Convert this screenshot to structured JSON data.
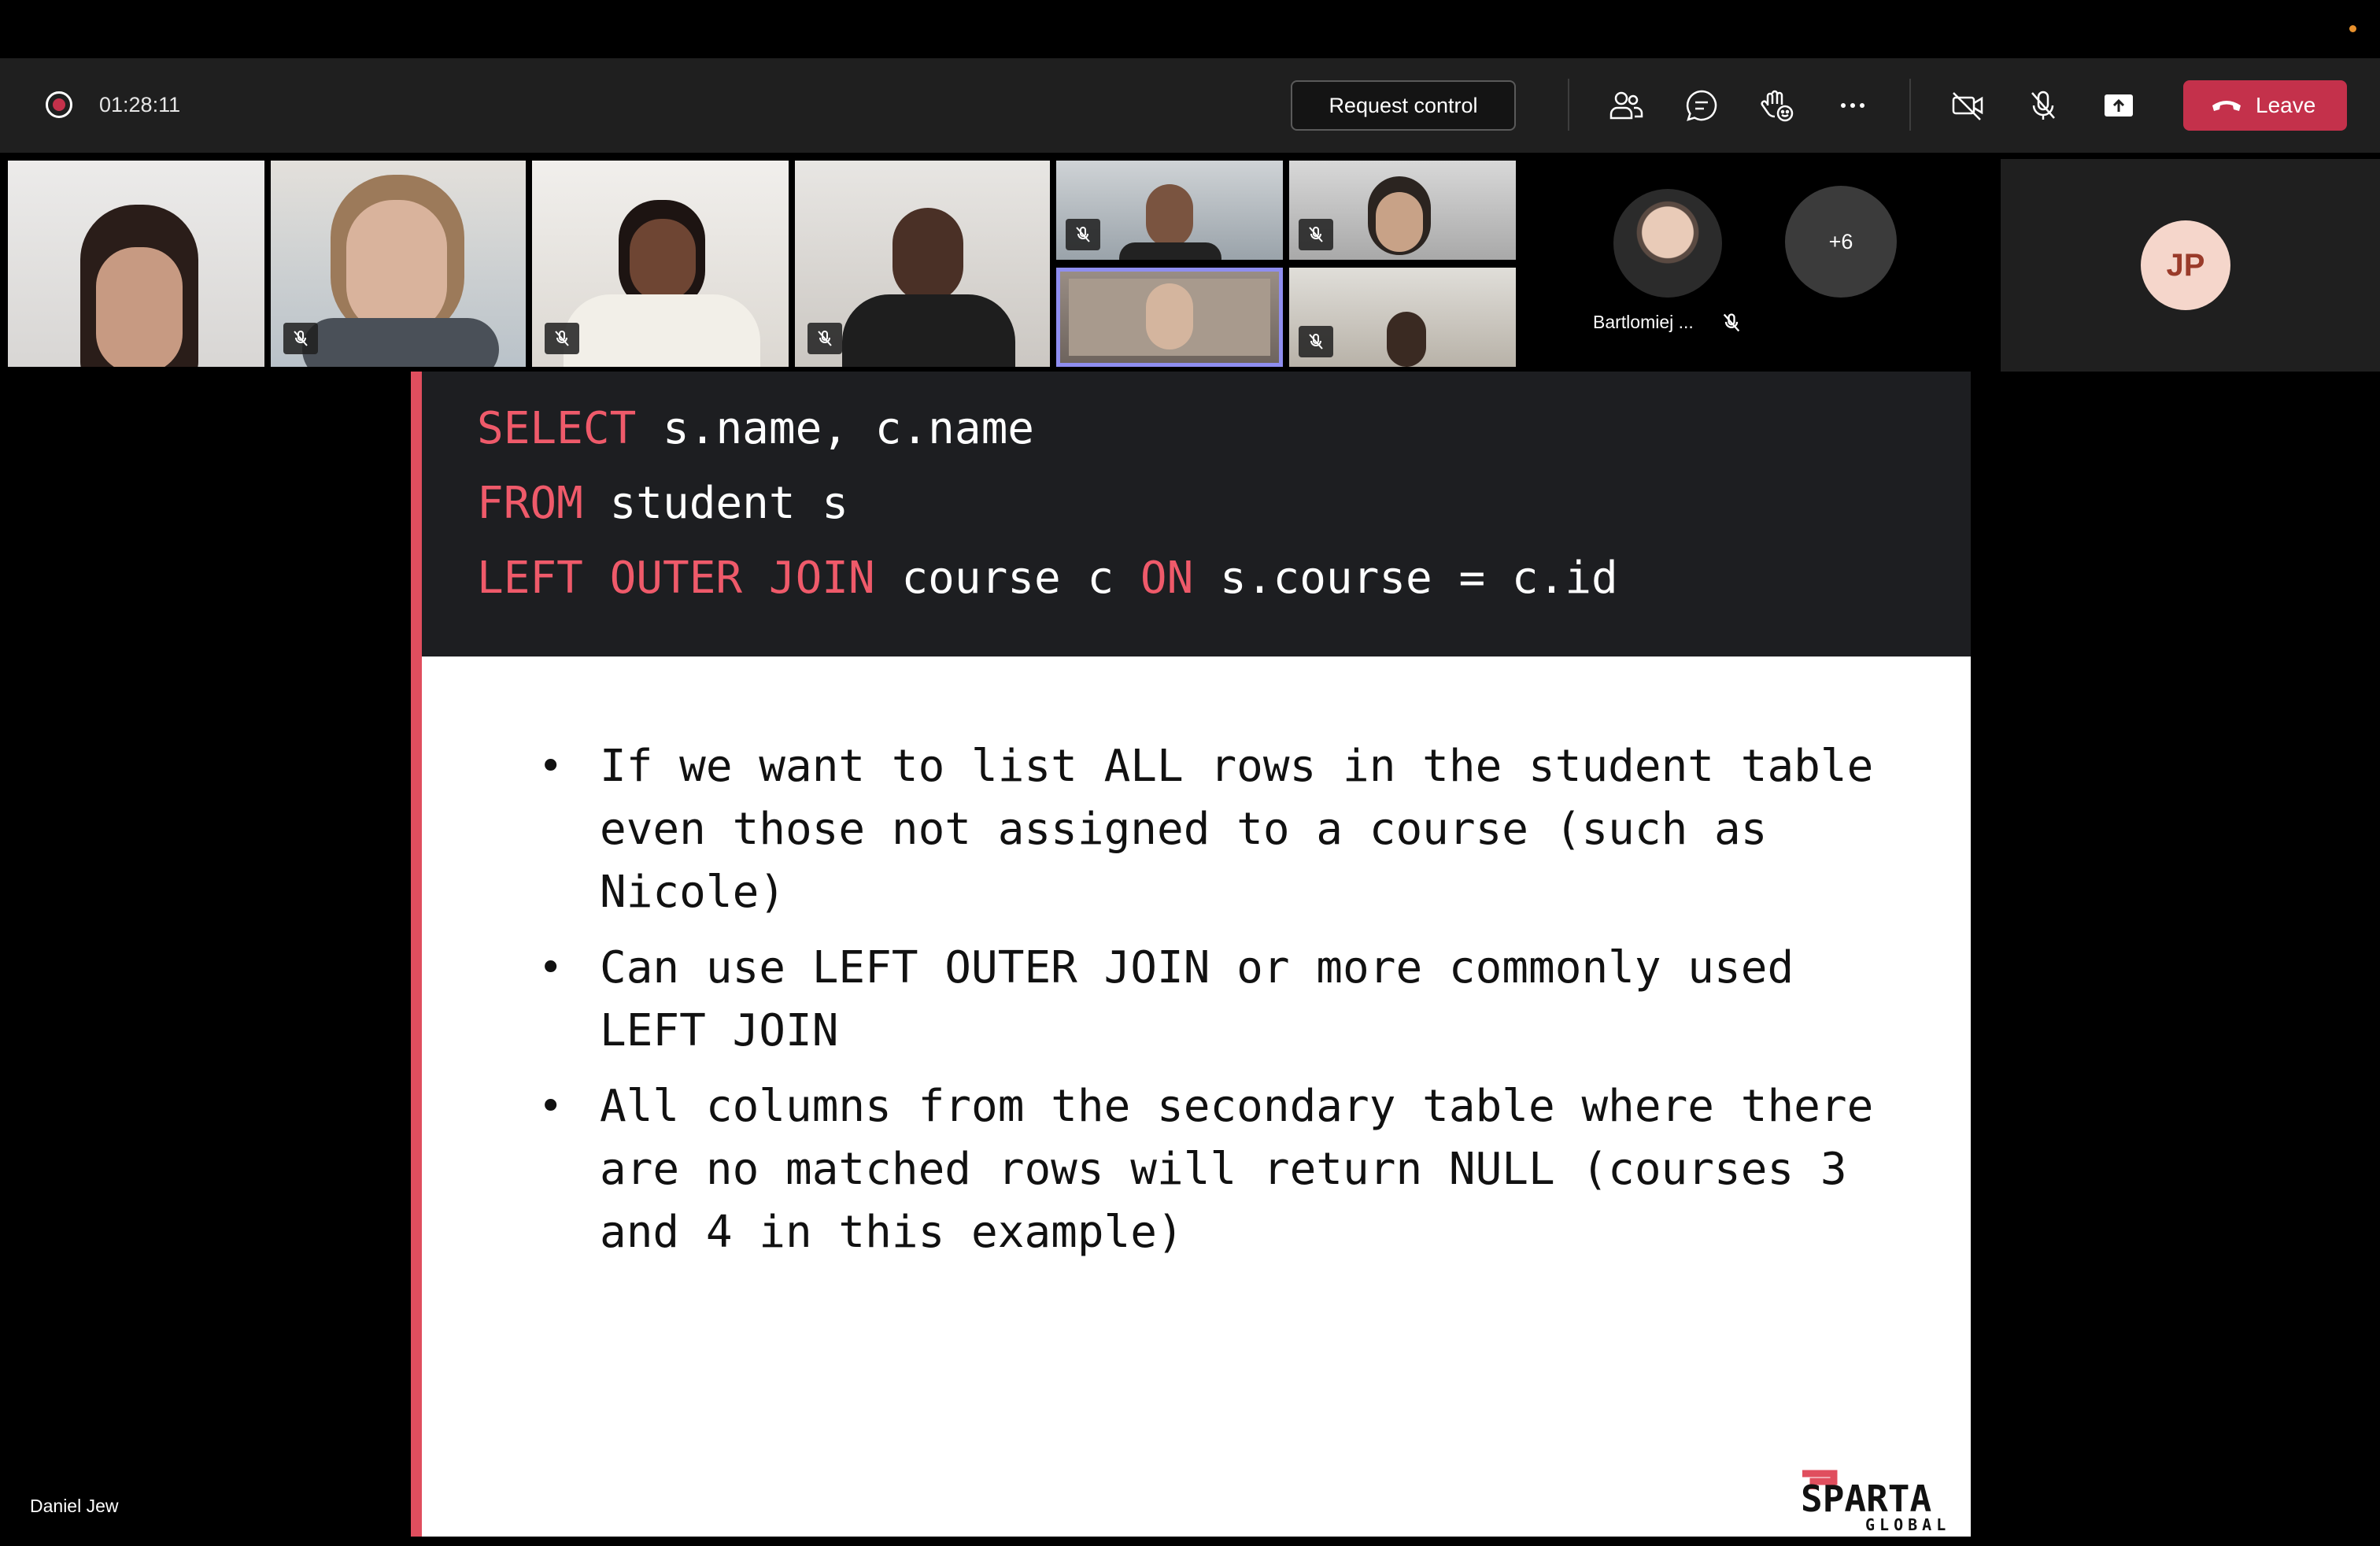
{
  "meeting": {
    "elapsed": "01:28:11",
    "request_control_label": "Request control",
    "leave_label": "Leave",
    "presenter_name": "Daniel Jew"
  },
  "participants": {
    "featured_name": "Bartlomiej ...",
    "overflow_count": "+6",
    "local_initials": "JP"
  },
  "slide": {
    "code": [
      {
        "kw1": "SELECT",
        "rest1": " s.name, c.name"
      },
      {
        "kw1": "FROM",
        "rest1": " student s"
      },
      {
        "kw1": "LEFT OUTER JOIN",
        "rest1": " course c ",
        "kw2": "ON",
        "rest2": " s.course = c.id"
      }
    ],
    "bullets": [
      "If we want to list ALL rows in the student table even those not assigned to a course (such as Nicole)",
      "Can use LEFT OUTER JOIN or more commonly used LEFT JOIN",
      "All columns from the secondary table where there are no matched rows will return NULL (courses 3 and 4 in this example)"
    ],
    "logo": {
      "main": "SPARTA",
      "sub": "GLOBAL"
    }
  },
  "icons": [
    "record-icon",
    "people-icon",
    "chat-icon",
    "raise-hand-icon",
    "more-icon",
    "camera-off-icon",
    "mic-off-icon",
    "share-icon",
    "hang-up-icon"
  ],
  "colors": {
    "accent": "#e04e5e",
    "leave": "#c4314b",
    "toolbar": "#1f1f1f",
    "code_bg": "#1d1e21",
    "keyword": "#ef5a6a"
  }
}
